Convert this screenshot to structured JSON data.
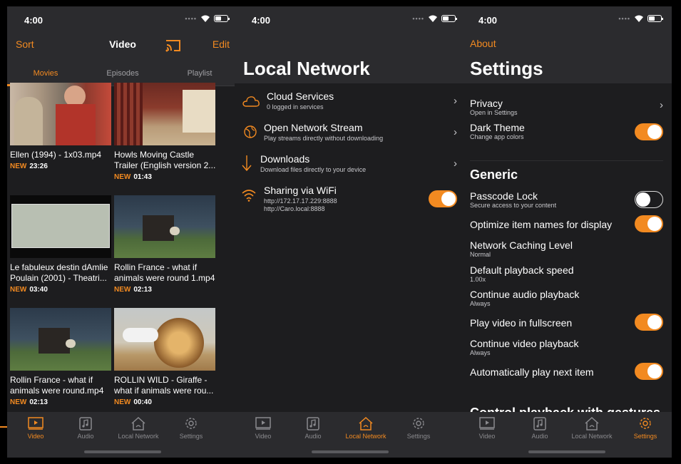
{
  "colors": {
    "accent": "#f28a21",
    "background": "#1d1d1f",
    "bar": "#2b2b2e"
  },
  "status": {
    "time": "4:00"
  },
  "phone1": {
    "nav": {
      "left": "Sort",
      "title": "Video",
      "right": "Edit",
      "cast_icon": "cast-icon"
    },
    "tabs": [
      "Movies",
      "Episodes",
      "Playlist"
    ],
    "items": [
      {
        "title": "Ellen (1994) - 1x03.mp4",
        "title2": "",
        "badge": "NEW",
        "duration": "23:26"
      },
      {
        "title": "Howls Moving Castle",
        "title2": "Trailer (English version 2...",
        "badge": "NEW",
        "duration": "01:43"
      },
      {
        "title": "Le fabuleux destin dAmlie",
        "title2": "Poulain (2001) - Theatri...",
        "badge": "NEW",
        "duration": "03:40"
      },
      {
        "title": "Rollin France - what if",
        "title2": "animals were round 1.mp4",
        "badge": "NEW",
        "duration": "02:13"
      },
      {
        "title": "Rollin France - what if",
        "title2": "animals were round.mp4",
        "badge": "NEW",
        "duration": "02:13"
      },
      {
        "title": "ROLLIN WILD - Giraffe  -",
        "title2": "what if animals were rou...",
        "badge": "NEW",
        "duration": "00:40"
      }
    ]
  },
  "phone2": {
    "title": "Local Network",
    "rows": [
      {
        "title": "Cloud Services",
        "subtitle": "0 logged in services",
        "icon": "cloud-icon"
      },
      {
        "title": "Open Network Stream",
        "subtitle": "Play streams directly without downloading",
        "icon": "network-stream-icon"
      },
      {
        "title": "Downloads",
        "subtitle": "Download files directly to your device",
        "icon": "download-icon"
      },
      {
        "title": "Sharing via WiFi",
        "subtitle": "http://172.17.17.229:8888",
        "subtitle2": "http://Caro.local:8888",
        "icon": "wifi-icon",
        "toggle": true
      }
    ]
  },
  "phone3": {
    "nav_left": "About",
    "title": "Settings",
    "privacy": {
      "title": "Privacy",
      "subtitle": "Open in Settings"
    },
    "dark_theme": {
      "title": "Dark Theme",
      "subtitle": "Change app colors",
      "on": true
    },
    "section_generic": "Generic",
    "settings": [
      {
        "title": "Passcode Lock",
        "subtitle": "Secure access to your content",
        "toggle": "off"
      },
      {
        "title": "Optimize item names for display",
        "subtitle": "",
        "toggle": "on"
      },
      {
        "title": "Network Caching Level",
        "subtitle": "Normal"
      },
      {
        "title": "Default playback speed",
        "subtitle": "1.00x"
      },
      {
        "title": "Continue audio playback",
        "subtitle": "Always"
      },
      {
        "title": "Play video in fullscreen",
        "subtitle": "",
        "toggle": "on"
      },
      {
        "title": "Continue video playback",
        "subtitle": "Always"
      },
      {
        "title": "Automatically play next item",
        "subtitle": "",
        "toggle": "on"
      }
    ],
    "section_partial": "Control playback with gestures"
  },
  "tabbar": [
    {
      "label": "Video",
      "icon": "video-icon"
    },
    {
      "label": "Audio",
      "icon": "audio-icon"
    },
    {
      "label": "Local Network",
      "icon": "local-network-icon"
    },
    {
      "label": "Settings",
      "icon": "settings-gear-icon"
    }
  ]
}
